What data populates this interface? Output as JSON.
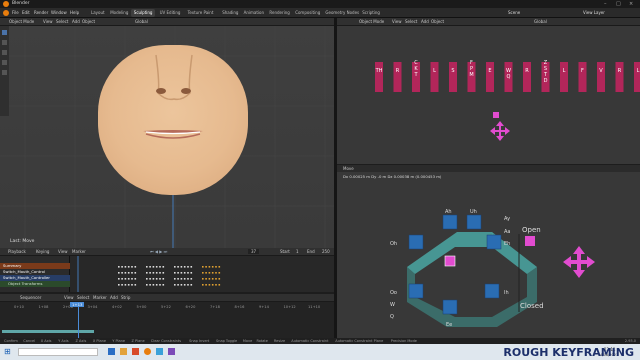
{
  "app": {
    "title": "Blender"
  },
  "menus": [
    "File",
    "Edit",
    "Render",
    "Window",
    "Help"
  ],
  "workspaces": [
    "Layout",
    "Modeling",
    "Sculpting",
    "UV Editing",
    "Texture Paint",
    "Shading",
    "Animation",
    "Rendering",
    "Compositing",
    "Geometry Nodes",
    "Scripting"
  ],
  "active_workspace": "Sculpting",
  "scene": {
    "label": "Scene",
    "view_layer": "View Layer"
  },
  "viewport": {
    "mode": "Object Mode",
    "menu": [
      "View",
      "Select",
      "Add",
      "Object"
    ],
    "transform": "Global",
    "last_op": "Last: Move"
  },
  "right_top": {
    "mode": "Object Mode",
    "menu": [
      "View",
      "Select",
      "Add",
      "Object"
    ],
    "transform": "Global"
  },
  "right_bottom": {
    "header": "Move",
    "info": "Dx 0.00025 m  Dy -0 m  Dz 0.00038 m (0.000453 m)",
    "phonemes_top": [
      "TH",
      "R",
      "C\nK\nT",
      "L",
      "S",
      "F\nP\nM",
      "E",
      "W\nQ",
      "R",
      "Z\nS\nT\nD",
      "L",
      "F",
      "V",
      "R",
      "L"
    ],
    "labels": {
      "open": "Open",
      "closed": "Closed",
      "ah": "Ah",
      "uh": "Uh",
      "ay": "Ay",
      "aa": "Aa",
      "eh": "Eh",
      "oh": "Oh",
      "oo": "Oo",
      "w": "W",
      "q": "Q",
      "ih": "Ih",
      "ee": "Ee"
    }
  },
  "timeline": {
    "menu": [
      "Playback",
      "Keying",
      "View",
      "Marker"
    ],
    "current_frame": "37",
    "start_label": "Start",
    "start": "1",
    "end_label": "End",
    "end": "250",
    "channels": [
      "Summary",
      "Switch_Mouth_Control",
      "Switch_Mouth_Controller",
      "Object Transforms"
    ]
  },
  "sequencer": {
    "editor": "Sequencer",
    "menu": [
      "View",
      "Select",
      "Marker",
      "Add",
      "Strip"
    ],
    "ticks": [
      "0+10",
      "1+08",
      "2+06",
      "3+04",
      "4+02",
      "5+00",
      "5+22",
      "6+20",
      "7+18",
      "8+16",
      "9+14",
      "10+12",
      "11+10"
    ],
    "current": "1+13"
  },
  "status": {
    "items": [
      "Confirm",
      "Cancel",
      "X Axis",
      "Y Axis",
      "Z Axis",
      "X Plane",
      "Y Plane",
      "Z Plane",
      "Clear Constraints",
      "Snap Invert",
      "Snap Toggle",
      "Move",
      "Rotate",
      "Resize",
      "Automatic Constraint",
      "Automatic Constraint Plane",
      "Precision Mode"
    ],
    "version": "2.93.0"
  },
  "taskbar": {
    "time": "12:11",
    "date": "14/08/2021"
  },
  "overlay_text": "ROUGH KEYFRAMING",
  "colors": {
    "accent": "#4a8cd8",
    "control": "#b2265a",
    "pink": "#e24cd0",
    "blue": "#2a6db3",
    "teal": "#4aa7a3"
  }
}
